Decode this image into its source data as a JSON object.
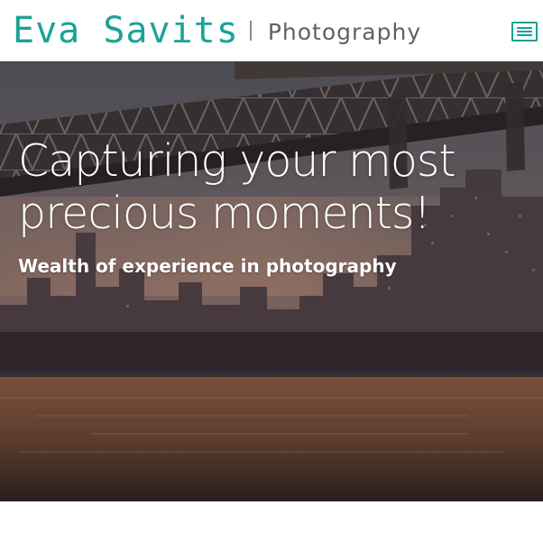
{
  "header": {
    "brand_name": "Eva Savits",
    "brand_subtitle": "Photography",
    "menu_icon": "hamburger-menu-icon"
  },
  "hero": {
    "headline_line1": "Capturing your most",
    "headline_line2": "precious moments!",
    "subheadline": "Wealth of experience in photography"
  },
  "colors": {
    "brand_accent": "#1aa395",
    "brand_subtitle": "#616161",
    "hero_text": "#ffffff"
  }
}
